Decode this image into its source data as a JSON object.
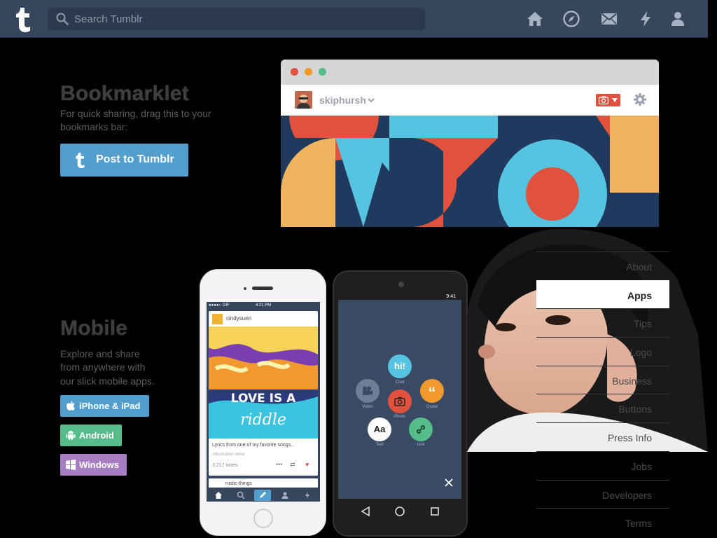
{
  "header": {
    "search_placeholder": "Search Tumblr",
    "icons": [
      "home-icon",
      "explore-icon",
      "inbox-icon",
      "activity-icon",
      "account-icon"
    ]
  },
  "bookmarklet": {
    "title": "Bookmarklet",
    "desc_line1": "For quick sharing, drag this to your",
    "desc_line2": "bookmarks bar:",
    "button_label": "Post to Tumblr"
  },
  "browser_mock": {
    "username": "skiphursh"
  },
  "mobile": {
    "title": "Mobile",
    "desc_line1": "Explore and share",
    "desc_line2": "from anywhere with",
    "desc_line3": "our slick mobile apps.",
    "buttons": [
      {
        "label": "iPhone & iPad",
        "color": "#529ecc"
      },
      {
        "label": "Android",
        "color": "#56bc8a"
      },
      {
        "label": "Windows",
        "color": "#a77dc2"
      }
    ]
  },
  "iphone_screen": {
    "time": "4:21 PM",
    "carrier": "●●●●○ GIF",
    "post_user": "cindysuen",
    "caption": "Lyrics from one of my favorite songs...",
    "tags": "#illustration  #love",
    "notes": "3,217 notes",
    "art_text_1": "LOVE IS A",
    "art_text_2": "riddle",
    "next_user": "rustic-things"
  },
  "android_screen": {
    "time": "9:41",
    "bubbles": [
      {
        "label": "Chat",
        "glyph": "hi!",
        "color": "#56c3e0"
      },
      {
        "label": "Video",
        "glyph": "",
        "color": "#6e7f95"
      },
      {
        "label": "Quote",
        "glyph": "“",
        "color": "#f2992e"
      },
      {
        "label": "Photo",
        "glyph": "",
        "color": "#e1523e"
      },
      {
        "label": "Text",
        "glyph": "Aa",
        "color": "#ffffff"
      },
      {
        "label": "Link",
        "glyph": "",
        "color": "#56bc8a"
      }
    ]
  },
  "nav": {
    "items": [
      "About",
      "Apps",
      "Tips",
      "Logo",
      "Business",
      "Buttons",
      "Press Info",
      "Jobs",
      "Developers",
      "Terms"
    ],
    "active": "Apps"
  },
  "colors": {
    "header_bg": "#36465d",
    "accent_blue": "#529ecc",
    "android_green": "#56bc8a",
    "windows_purple": "#a77dc2"
  }
}
